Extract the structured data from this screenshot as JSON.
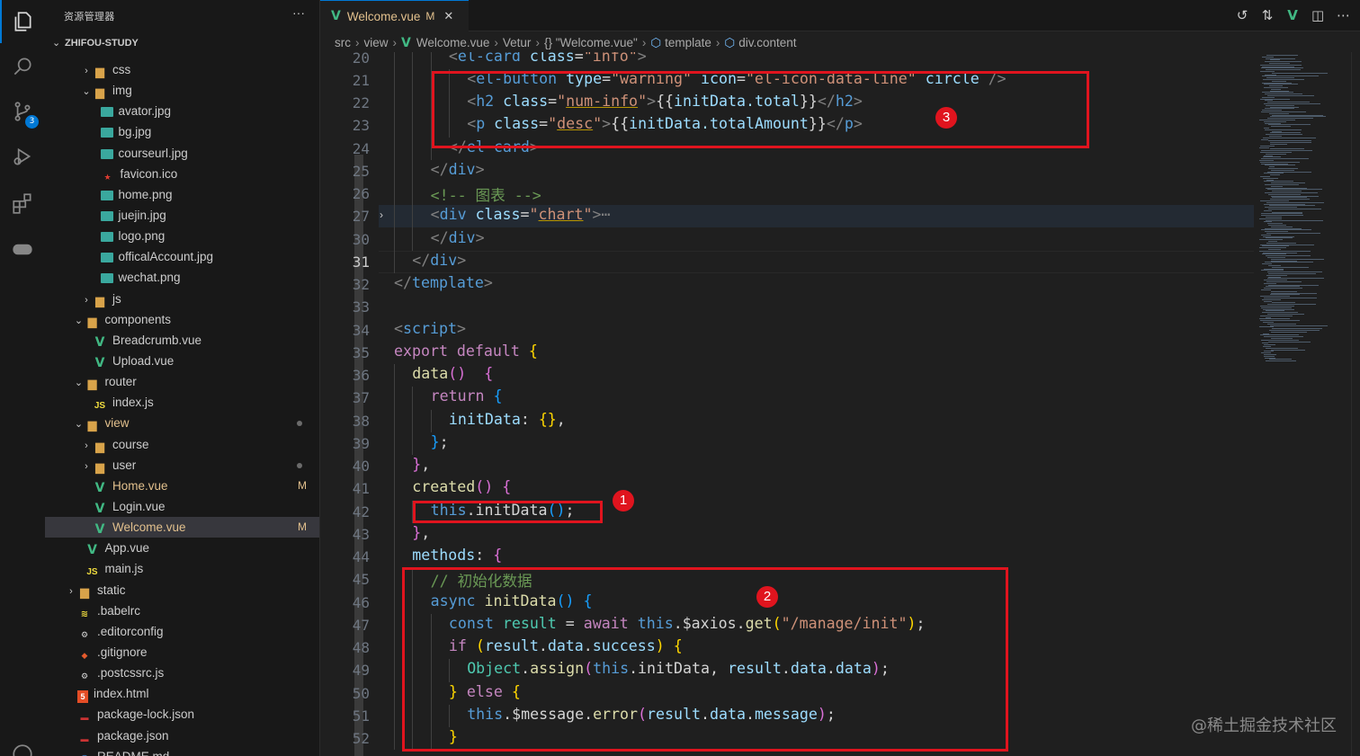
{
  "activity_bar": {
    "scm_badge": "3"
  },
  "explorer": {
    "title": "资源管理器",
    "more": "···",
    "root": "ZHIFOU-STUDY",
    "items": [
      {
        "label": "css",
        "kind": "folder",
        "depth": 2,
        "chev": "›"
      },
      {
        "label": "img",
        "kind": "folder-open",
        "depth": 2,
        "chev": "⌄"
      },
      {
        "label": "avator.jpg",
        "kind": "image",
        "depth": 3
      },
      {
        "label": "bg.jpg",
        "kind": "image",
        "depth": 3
      },
      {
        "label": "courseurl.jpg",
        "kind": "image",
        "depth": 3
      },
      {
        "label": "favicon.ico",
        "kind": "ico",
        "depth": 3
      },
      {
        "label": "home.png",
        "kind": "image",
        "depth": 3
      },
      {
        "label": "juejin.jpg",
        "kind": "image",
        "depth": 3
      },
      {
        "label": "logo.png",
        "kind": "image",
        "depth": 3
      },
      {
        "label": "officalAccount.jpg",
        "kind": "image",
        "depth": 3
      },
      {
        "label": "wechat.png",
        "kind": "image",
        "depth": 3
      },
      {
        "label": "js",
        "kind": "folder",
        "depth": 2,
        "chev": "›"
      },
      {
        "label": "components",
        "kind": "folder-open",
        "depth": 1,
        "chev": "⌄"
      },
      {
        "label": "Breadcrumb.vue",
        "kind": "vue",
        "depth": 2
      },
      {
        "label": "Upload.vue",
        "kind": "vue",
        "depth": 2
      },
      {
        "label": "router",
        "kind": "folder-open",
        "depth": 1,
        "chev": "⌄"
      },
      {
        "label": "index.js",
        "kind": "js",
        "depth": 2
      },
      {
        "label": "view",
        "kind": "folder-open",
        "depth": 1,
        "chev": "⌄",
        "modified": true,
        "dot": true
      },
      {
        "label": "course",
        "kind": "folder",
        "depth": 2,
        "chev": "›"
      },
      {
        "label": "user",
        "kind": "folder",
        "depth": 2,
        "chev": "›",
        "dot": true
      },
      {
        "label": "Home.vue",
        "kind": "vue",
        "depth": 2,
        "modified": true,
        "status": "M"
      },
      {
        "label": "Login.vue",
        "kind": "vue",
        "depth": 2
      },
      {
        "label": "Welcome.vue",
        "kind": "vue",
        "depth": 2,
        "modified": true,
        "status": "M",
        "selected": true
      },
      {
        "label": "App.vue",
        "kind": "vue",
        "depth": 1
      },
      {
        "label": "main.js",
        "kind": "js",
        "depth": 1
      },
      {
        "label": "static",
        "kind": "folder",
        "depth": 0,
        "chev": "›"
      },
      {
        "label": ".babelrc",
        "kind": "babel",
        "depth": 0
      },
      {
        "label": ".editorconfig",
        "kind": "gear",
        "depth": 0
      },
      {
        "label": ".gitignore",
        "kind": "git",
        "depth": 0
      },
      {
        "label": ".postcssrc.js",
        "kind": "gear",
        "depth": 0
      },
      {
        "label": "index.html",
        "kind": "html",
        "depth": 0
      },
      {
        "label": "package-lock.json",
        "kind": "npm",
        "depth": 0
      },
      {
        "label": "package.json",
        "kind": "npm",
        "depth": 0
      },
      {
        "label": "README.md",
        "kind": "md",
        "depth": 0
      }
    ]
  },
  "tab": {
    "name": "Welcome.vue",
    "status": "M",
    "close": "✕"
  },
  "toolbar_icons": [
    "history-icon",
    "compare-icon",
    "vue-icon",
    "split-editor-icon",
    "more-icon"
  ],
  "breadcrumb": [
    "src",
    "view",
    "Welcome.vue",
    "Vetur",
    "{} \"Welcome.vue\"",
    "template",
    "div.content"
  ],
  "editor": {
    "current_line": 31,
    "lines": [
      {
        "n": 20,
        "i": 3,
        "t": [
          [
            "k8",
            "<"
          ],
          [
            "k1",
            "el-card"
          ],
          [
            "k2",
            " class"
          ],
          [
            "",
            "="
          ],
          [
            "k3",
            "\"info\""
          ],
          [
            "k8",
            ">"
          ]
        ]
      },
      {
        "n": 21,
        "i": 4,
        "t": [
          [
            "k8",
            "<"
          ],
          [
            "k1",
            "el-button"
          ],
          [
            "k2",
            " type"
          ],
          [
            "",
            "="
          ],
          [
            "k3",
            "\"warning\""
          ],
          [
            "k2",
            " icon"
          ],
          [
            "",
            "="
          ],
          [
            "k3",
            "\"el-icon-data-line\""
          ],
          [
            "k2",
            " circle"
          ],
          [
            "k8",
            " />"
          ]
        ]
      },
      {
        "n": 22,
        "i": 4,
        "t": [
          [
            "k8",
            "<"
          ],
          [
            "k1",
            "h2"
          ],
          [
            "k2",
            " class"
          ],
          [
            "",
            "="
          ],
          [
            "k3",
            "\""
          ],
          [
            "k3 ul",
            "num-info"
          ],
          [
            "k3",
            "\""
          ],
          [
            "k8",
            ">"
          ],
          [
            "",
            "{{"
          ],
          [
            "k2",
            "initData.total"
          ],
          [
            "",
            "}}"
          ],
          [
            "k8",
            "</"
          ],
          [
            "k1",
            "h2"
          ],
          [
            "k8",
            ">"
          ]
        ]
      },
      {
        "n": 23,
        "i": 4,
        "t": [
          [
            "k8",
            "<"
          ],
          [
            "k1",
            "p"
          ],
          [
            "k2",
            " class"
          ],
          [
            "",
            "="
          ],
          [
            "k3",
            "\""
          ],
          [
            "k3 ul",
            "desc"
          ],
          [
            "k3",
            "\""
          ],
          [
            "k8",
            ">"
          ],
          [
            "",
            "{{"
          ],
          [
            "k2",
            "initData.totalAmount"
          ],
          [
            "",
            "}}"
          ],
          [
            "k8",
            "</"
          ],
          [
            "k1",
            "p"
          ],
          [
            "k8",
            ">"
          ]
        ]
      },
      {
        "n": 24,
        "i": 3,
        "t": [
          [
            "k8",
            "</"
          ],
          [
            "k1",
            "el-card"
          ],
          [
            "k8",
            ">"
          ]
        ]
      },
      {
        "n": 25,
        "i": 2,
        "t": [
          [
            "k8",
            "</"
          ],
          [
            "k1",
            "div"
          ],
          [
            "k8",
            ">"
          ]
        ]
      },
      {
        "n": 26,
        "i": 2,
        "t": [
          [
            "k7",
            "<!-- 图表 -->"
          ]
        ]
      },
      {
        "n": 27,
        "i": 2,
        "t": [
          [
            "k8",
            "<"
          ],
          [
            "k1",
            "div"
          ],
          [
            "k2",
            " class"
          ],
          [
            "",
            "="
          ],
          [
            "k3",
            "\""
          ],
          [
            "k3 ul",
            "chart"
          ],
          [
            "k3",
            "\""
          ],
          [
            "k8",
            ">"
          ],
          [
            "k8",
            "⋯"
          ]
        ]
      },
      {
        "n": 30,
        "i": 2,
        "t": [
          [
            "k8",
            "</"
          ],
          [
            "k1",
            "div"
          ],
          [
            "k8",
            ">"
          ]
        ]
      },
      {
        "n": 31,
        "i": 1,
        "t": [
          [
            "k8",
            "</"
          ],
          [
            "k1",
            "div"
          ],
          [
            "k8",
            ">"
          ]
        ]
      },
      {
        "n": 32,
        "i": 0,
        "t": [
          [
            "k8",
            "</"
          ],
          [
            "k1",
            "template"
          ],
          [
            "k8",
            ">"
          ]
        ]
      },
      {
        "n": 33,
        "i": 0,
        "t": []
      },
      {
        "n": 34,
        "i": 0,
        "t": [
          [
            "k8",
            "<"
          ],
          [
            "k1",
            "script"
          ],
          [
            "k8",
            ">"
          ]
        ]
      },
      {
        "n": 35,
        "i": 0,
        "t": [
          [
            "k4",
            "export default "
          ],
          [
            "k9",
            "{"
          ]
        ]
      },
      {
        "n": 36,
        "i": 1,
        "t": [
          [
            "k5",
            "data"
          ],
          [
            "k10",
            "()"
          ],
          [
            "",
            "  "
          ],
          [
            "k10",
            "{"
          ]
        ]
      },
      {
        "n": 37,
        "i": 2,
        "t": [
          [
            "k4",
            "return "
          ],
          [
            "k11",
            "{"
          ]
        ]
      },
      {
        "n": 38,
        "i": 3,
        "t": [
          [
            "k2",
            "initData"
          ],
          [
            "",
            ": "
          ],
          [
            "k9",
            "{}"
          ],
          [
            "",
            ","
          ]
        ]
      },
      {
        "n": 39,
        "i": 2,
        "t": [
          [
            "k11",
            "}"
          ],
          [
            "",
            ";"
          ]
        ]
      },
      {
        "n": 40,
        "i": 1,
        "t": [
          [
            "k10",
            "}"
          ],
          [
            "",
            ","
          ]
        ]
      },
      {
        "n": 41,
        "i": 1,
        "t": [
          [
            "k5",
            "created"
          ],
          [
            "k10",
            "()"
          ],
          [
            "",
            " "
          ],
          [
            "k10",
            "{"
          ]
        ]
      },
      {
        "n": 42,
        "i": 2,
        "t": [
          [
            "k1",
            "this"
          ],
          [
            "",
            ".initData"
          ],
          [
            "k11",
            "()"
          ],
          [
            "",
            ";"
          ]
        ]
      },
      {
        "n": 43,
        "i": 1,
        "t": [
          [
            "k10",
            "}"
          ],
          [
            "",
            ","
          ]
        ]
      },
      {
        "n": 44,
        "i": 1,
        "t": [
          [
            "k2",
            "methods"
          ],
          [
            "",
            ": "
          ],
          [
            "k10",
            "{"
          ]
        ]
      },
      {
        "n": 45,
        "i": 2,
        "t": [
          [
            "k7",
            "// 初始化数据"
          ]
        ]
      },
      {
        "n": 46,
        "i": 2,
        "t": [
          [
            "k1",
            "async "
          ],
          [
            "k5",
            "initData"
          ],
          [
            "k11",
            "()"
          ],
          [
            "",
            " "
          ],
          [
            "k11",
            "{"
          ]
        ]
      },
      {
        "n": 47,
        "i": 3,
        "t": [
          [
            "k1",
            "const "
          ],
          [
            "k6",
            "result"
          ],
          [
            "",
            " = "
          ],
          [
            "k4",
            "await "
          ],
          [
            "k1",
            "this"
          ],
          [
            "",
            ".$axios."
          ],
          [
            "k5",
            "get"
          ],
          [
            "k9",
            "("
          ],
          [
            "k3",
            "\"/manage/init\""
          ],
          [
            "k9",
            ")"
          ],
          [
            "",
            ";"
          ]
        ]
      },
      {
        "n": 48,
        "i": 3,
        "t": [
          [
            "k4",
            "if "
          ],
          [
            "k9",
            "("
          ],
          [
            "k2",
            "result"
          ],
          [
            "",
            "."
          ],
          [
            "k2",
            "data"
          ],
          [
            "",
            "."
          ],
          [
            "k2",
            "success"
          ],
          [
            "k9",
            ")"
          ],
          [
            "",
            " "
          ],
          [
            "k9",
            "{"
          ]
        ]
      },
      {
        "n": 49,
        "i": 4,
        "t": [
          [
            "k6",
            "Object"
          ],
          [
            "",
            "."
          ],
          [
            "k5",
            "assign"
          ],
          [
            "k10",
            "("
          ],
          [
            "k1",
            "this"
          ],
          [
            "",
            ".initData, "
          ],
          [
            "k2",
            "result"
          ],
          [
            "",
            "."
          ],
          [
            "k2",
            "data"
          ],
          [
            "",
            "."
          ],
          [
            "k2",
            "data"
          ],
          [
            "k10",
            ")"
          ],
          [
            "",
            ";"
          ]
        ]
      },
      {
        "n": 50,
        "i": 3,
        "t": [
          [
            "k9",
            "}"
          ],
          [
            "",
            " "
          ],
          [
            "k4",
            "else "
          ],
          [
            "k9",
            "{"
          ]
        ]
      },
      {
        "n": 51,
        "i": 4,
        "t": [
          [
            "k1",
            "this"
          ],
          [
            "",
            ".$message."
          ],
          [
            "k5",
            "error"
          ],
          [
            "k10",
            "("
          ],
          [
            "k2",
            "result"
          ],
          [
            "",
            "."
          ],
          [
            "k2",
            "data"
          ],
          [
            "",
            "."
          ],
          [
            "k2",
            "message"
          ],
          [
            "k10",
            ")"
          ],
          [
            "",
            ";"
          ]
        ]
      },
      {
        "n": 52,
        "i": 3,
        "t": [
          [
            "k9",
            "}"
          ]
        ]
      }
    ]
  },
  "annotations": [
    "1",
    "2",
    "3"
  ],
  "watermark": "@稀土掘金技术社区"
}
